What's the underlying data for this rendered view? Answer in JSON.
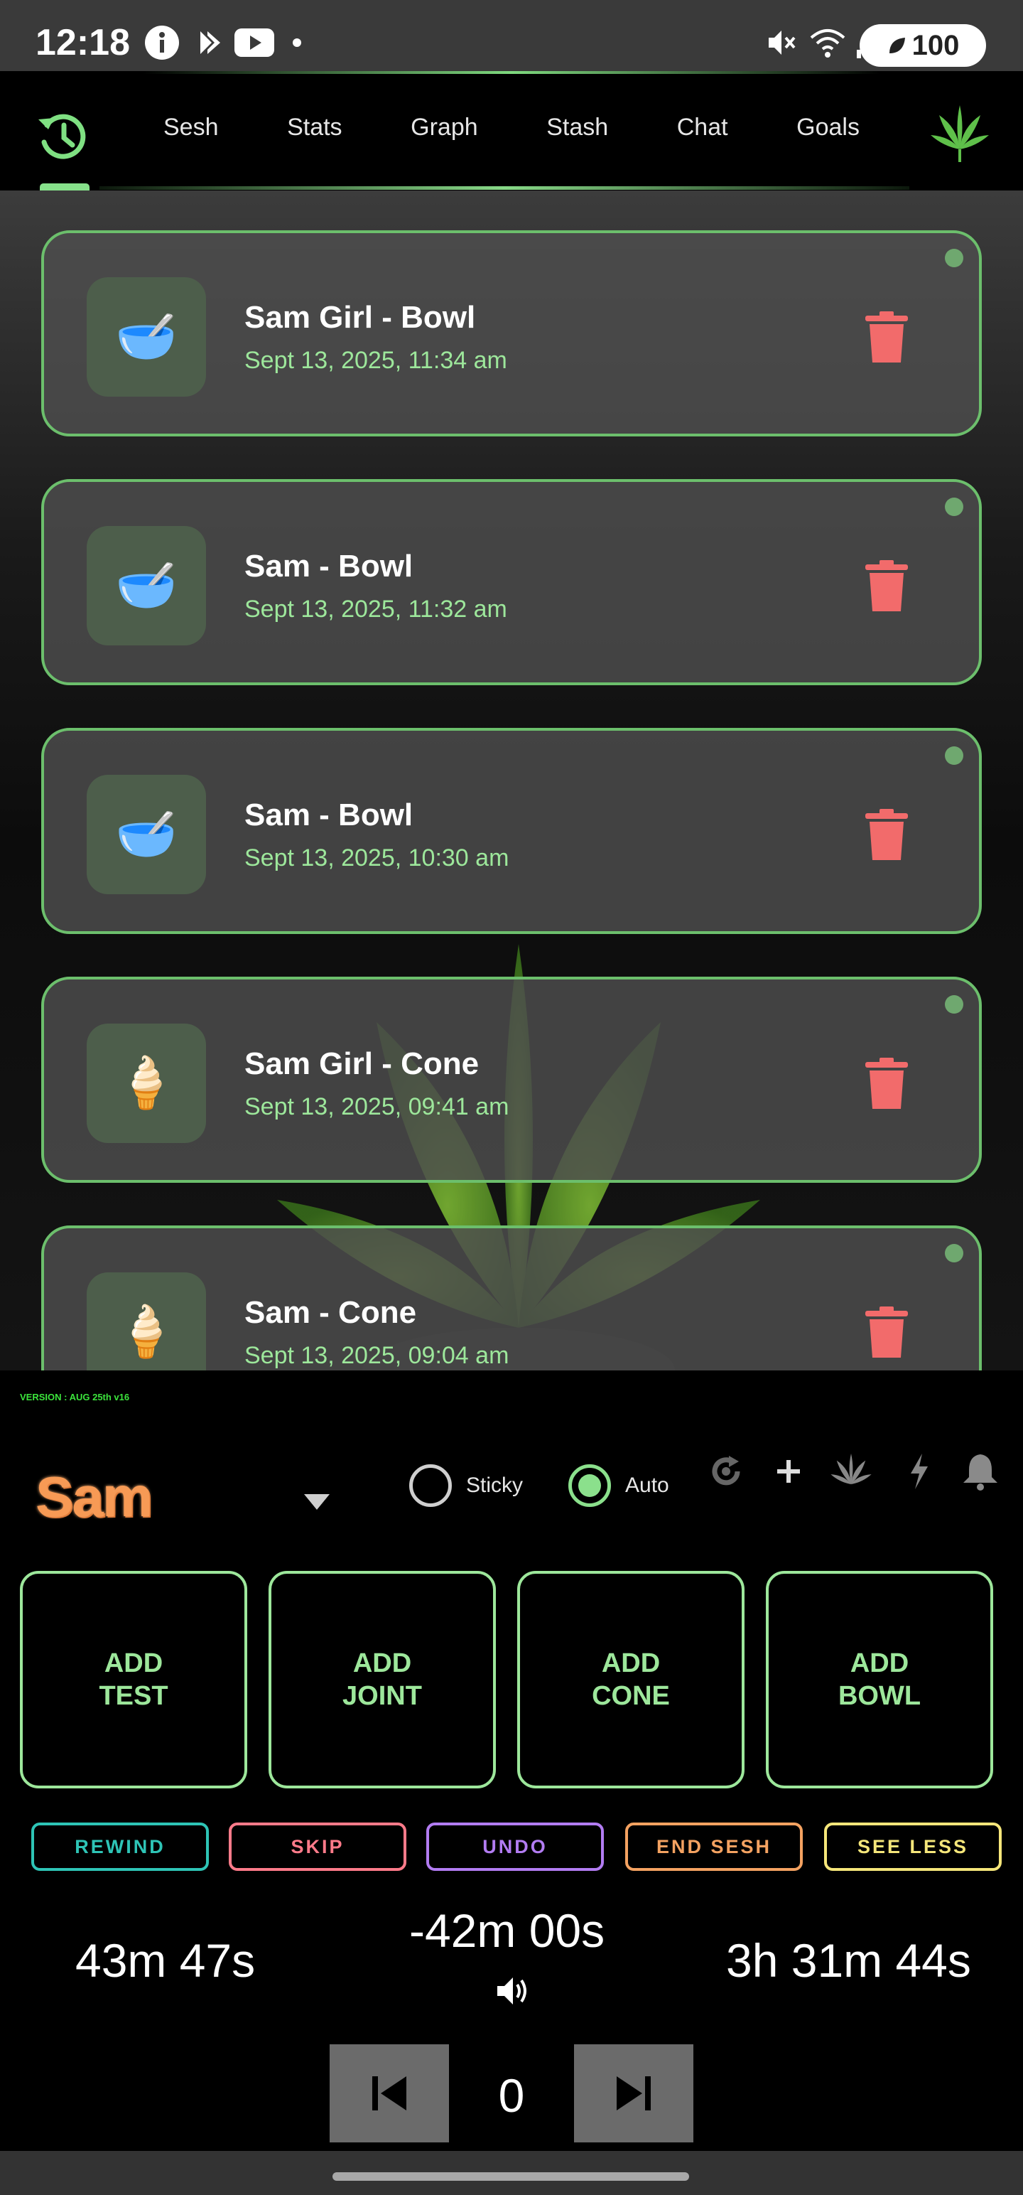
{
  "status_bar": {
    "time": "12:18",
    "battery": "100"
  },
  "nav": {
    "tabs": [
      "Sesh",
      "Stats",
      "Graph",
      "Stash",
      "Chat",
      "Goals"
    ]
  },
  "entries": [
    {
      "title": "Sam Girl - Bowl",
      "time": "Sept 13, 2025, 11:34 am",
      "icon": "bowl-icon",
      "emoji": "🥣"
    },
    {
      "title": "Sam - Bowl",
      "time": "Sept 13, 2025, 11:32 am",
      "icon": "bowl-icon",
      "emoji": "🥣"
    },
    {
      "title": "Sam - Bowl",
      "time": "Sept 13, 2025, 10:30 am",
      "icon": "bowl-icon",
      "emoji": "🥣"
    },
    {
      "title": "Sam Girl - Cone",
      "time": "Sept 13, 2025, 09:41 am",
      "icon": "cone-icon",
      "emoji": "🍦"
    },
    {
      "title": "Sam - Cone",
      "time": "Sept 13, 2025, 09:04 am",
      "icon": "cone-icon",
      "emoji": "🍦"
    }
  ],
  "version": "VERSION : AUG 25th v16",
  "user": {
    "name": "Sam"
  },
  "modes": {
    "sticky": {
      "label": "Sticky",
      "selected": false
    },
    "auto": {
      "label": "Auto",
      "selected": true
    }
  },
  "add_buttons": [
    {
      "label": "ADD\nTEST"
    },
    {
      "label": "ADD\nJOINT"
    },
    {
      "label": "ADD\nCONE"
    },
    {
      "label": "ADD\nBOWL"
    }
  ],
  "actions": [
    {
      "label": "REWIND",
      "color": "#2ec4b6"
    },
    {
      "label": "SKIP",
      "color": "#ff7b8a"
    },
    {
      "label": "UNDO",
      "color": "#b27cf2"
    },
    {
      "label": "END SESH",
      "color": "#f4a261"
    },
    {
      "label": "SEE LESS",
      "color": "#f5e67a"
    }
  ],
  "timers": {
    "left": "43m 47s",
    "center": "-42m 00s",
    "right": "3h 31m 44s"
  },
  "counter": "0",
  "colors": {
    "accent": "#9de79b",
    "card_border": "#6cbf6c",
    "trash": "#f26b6b",
    "user_name": "#f79a55"
  }
}
